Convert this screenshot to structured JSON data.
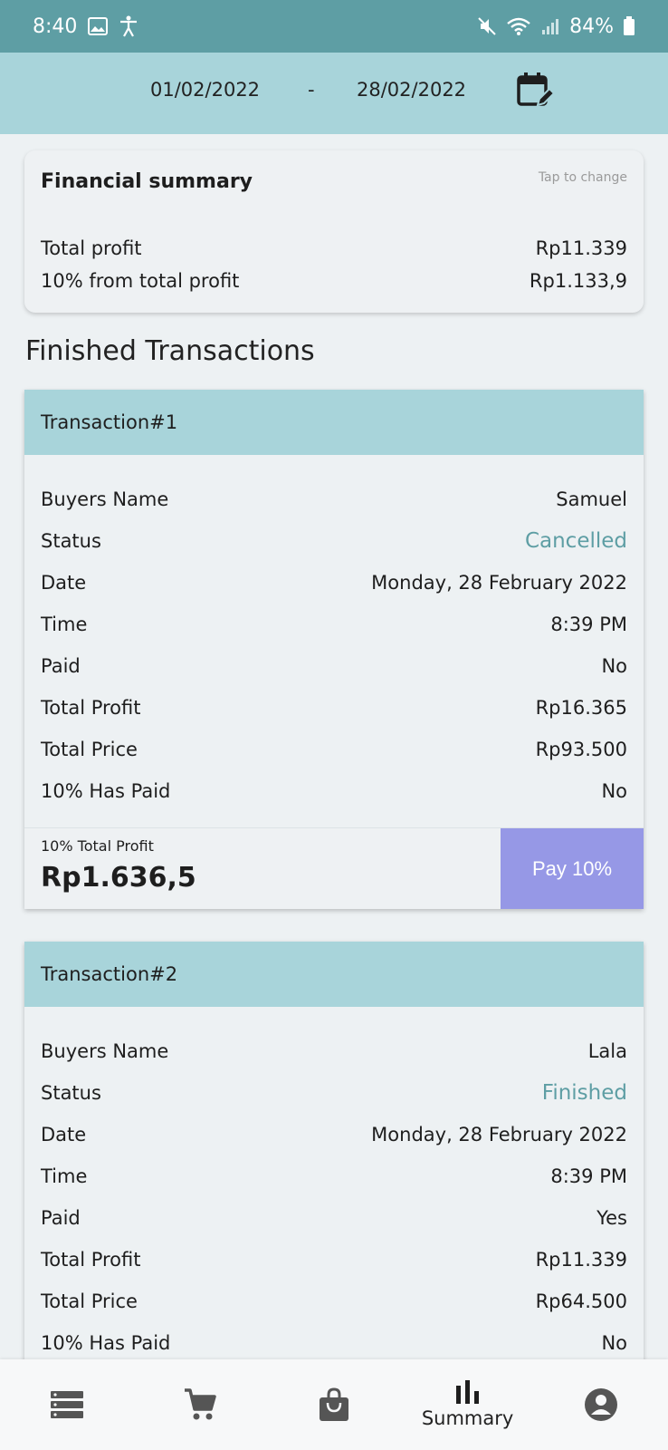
{
  "status_bar": {
    "time": "8:40",
    "battery": "84%",
    "icons": [
      "image-icon",
      "accessibility-icon",
      "mute-icon",
      "wifi-icon",
      "signal-icon",
      "battery-icon"
    ]
  },
  "date_range": {
    "from": "01/02/2022",
    "separator": "-",
    "to": "28/02/2022",
    "icon": "calendar-edit-icon"
  },
  "financial_summary": {
    "title": "Financial summary",
    "tap_hint": "Tap to change",
    "rows": [
      {
        "label": "Total profit",
        "value": "Rp11.339"
      },
      {
        "label": "10% from total profit",
        "value": "Rp1.133,9"
      }
    ]
  },
  "section_title": "Finished Transactions",
  "transactions": [
    {
      "header": "Transaction#1",
      "rows": [
        {
          "label": "Buyers Name",
          "value": "Samuel"
        },
        {
          "label": "Status",
          "value": "Cancelled"
        },
        {
          "label": "Date",
          "value": "Monday, 28 February 2022"
        },
        {
          "label": "Time",
          "value": "8:39 PM"
        },
        {
          "label": "Paid",
          "value": "No"
        },
        {
          "label": "Total Profit",
          "value": "Rp16.365"
        },
        {
          "label": "Total Price",
          "value": "Rp93.500"
        },
        {
          "label": "10% Has Paid",
          "value": "No"
        }
      ],
      "footer_label": "10% Total Profit",
      "footer_amount": "Rp1.636,5",
      "pay_label": "Pay 10%"
    },
    {
      "header": "Transaction#2",
      "rows": [
        {
          "label": "Buyers Name",
          "value": "Lala"
        },
        {
          "label": "Status",
          "value": "Finished"
        },
        {
          "label": "Date",
          "value": "Monday, 28 February 2022"
        },
        {
          "label": "Time",
          "value": "8:39 PM"
        },
        {
          "label": "Paid",
          "value": "Yes"
        },
        {
          "label": "Total Profit",
          "value": "Rp11.339"
        },
        {
          "label": "Total Price",
          "value": "Rp64.500"
        },
        {
          "label": "10% Has Paid",
          "value": "No"
        }
      ]
    }
  ],
  "bottom_nav": {
    "items": [
      {
        "icon": "list-icon",
        "label": ""
      },
      {
        "icon": "cart-icon",
        "label": ""
      },
      {
        "icon": "shopping-bag-icon",
        "label": ""
      },
      {
        "icon": "bar-chart-icon",
        "label": "Summary"
      },
      {
        "icon": "account-icon",
        "label": ""
      }
    ]
  },
  "colors": {
    "status_bar": "#5e9ea4",
    "header_bg": "#a8d4da",
    "status_text": "#5e9ea4",
    "pay_button": "#9698e6",
    "background": "#edf1f3"
  }
}
